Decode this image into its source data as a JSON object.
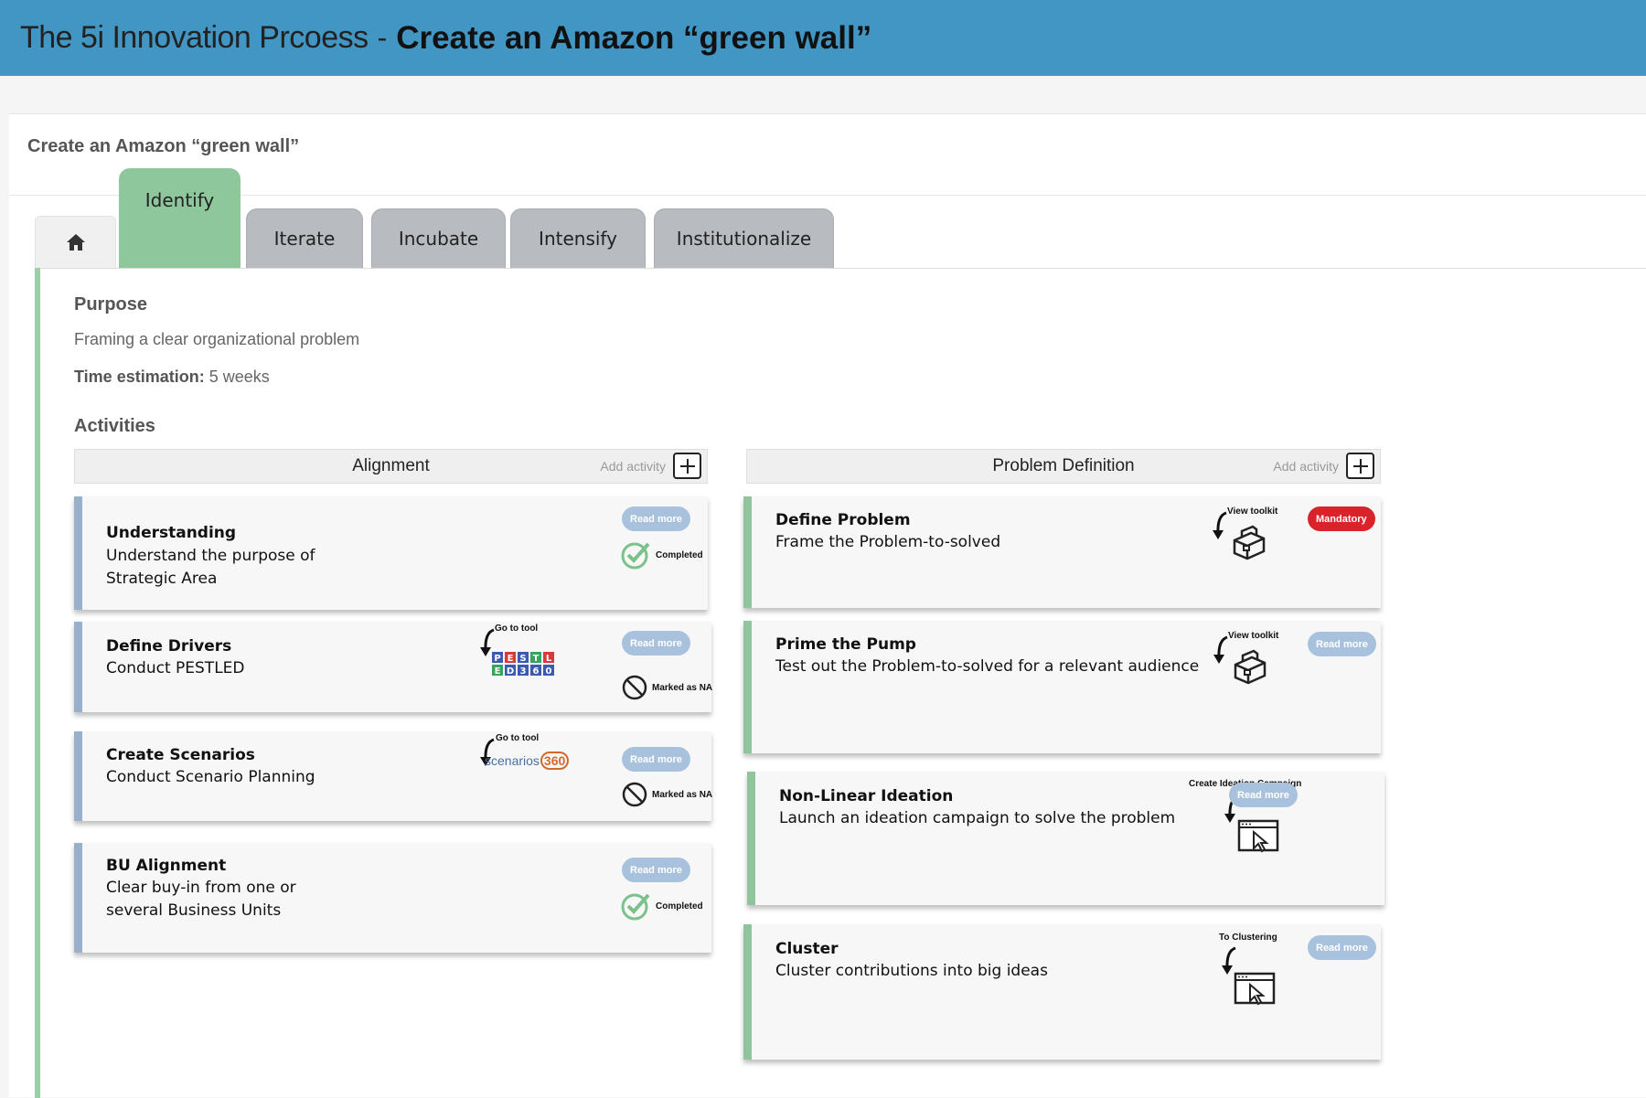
{
  "header": {
    "prefix": "The 5i Innovation Prcoess",
    "separator": "-",
    "title": "Create an Amazon “green wall”"
  },
  "page_title": "Create an Amazon “green wall”",
  "tabs": [
    {
      "label": "Identify",
      "active": true
    },
    {
      "label": "Iterate"
    },
    {
      "label": "Incubate"
    },
    {
      "label": "Intensify"
    },
    {
      "label": "Institutionalize"
    }
  ],
  "home_icon": "home-icon",
  "purpose": {
    "heading": "Purpose",
    "text": "Framing a clear organizational problem",
    "time_label": "Time estimation:",
    "time_value": "5 weeks"
  },
  "activities_heading": "Activities",
  "columns": [
    {
      "title": "Alignment",
      "add_label": "Add activity",
      "cards": [
        {
          "title": "Understanding",
          "desc": "Understand the purpose of  Strategic Area",
          "button": "Read more",
          "status": "Completed"
        },
        {
          "title": "Define Drivers",
          "desc": "Conduct PESTLED",
          "button": "Read more",
          "status": "Marked as NA",
          "tool_label": "Go to tool",
          "tool_letters": [
            "P",
            "E",
            "S",
            "T",
            "L",
            "E",
            "D",
            "3",
            "6",
            "0"
          ]
        },
        {
          "title": "Create Scenarios",
          "desc": "Conduct Scenario Planning",
          "button": "Read more",
          "status": "Marked as NA",
          "tool_label": "Go to tool",
          "tool_name": "scenarios",
          "tool_num": "360"
        },
        {
          "title": "BU Alignment",
          "desc": "Clear buy-in from one or several Business Units",
          "button": "Read more",
          "status": "Completed"
        }
      ]
    },
    {
      "title": "Problem Definition",
      "add_label": "Add activity",
      "cards": [
        {
          "title": "Define Problem",
          "desc": "Frame the Problem-to-solved",
          "button": "Mandatory",
          "tool_label": "View toolkit"
        },
        {
          "title": "Prime the Pump",
          "desc": "Test out the Problem-to-solved for a relevant audience",
          "button": "Read more",
          "tool_label": "View toolkit"
        },
        {
          "title": "Non-Linear Ideation",
          "desc": "Launch an ideation campaign to solve the problem",
          "button": "Read more",
          "tool_label": "Create Ideation Campaign"
        },
        {
          "title": "Cluster",
          "desc": "Cluster contributions into big ideas",
          "button": "Read more",
          "tool_label": "To Clustering"
        }
      ]
    }
  ],
  "colors": {
    "header": "#4296c4",
    "active_tab": "#8fc79d",
    "pill": "#a8c2dd",
    "mandatory": "#d9232b",
    "completed": "#7cc08b"
  }
}
